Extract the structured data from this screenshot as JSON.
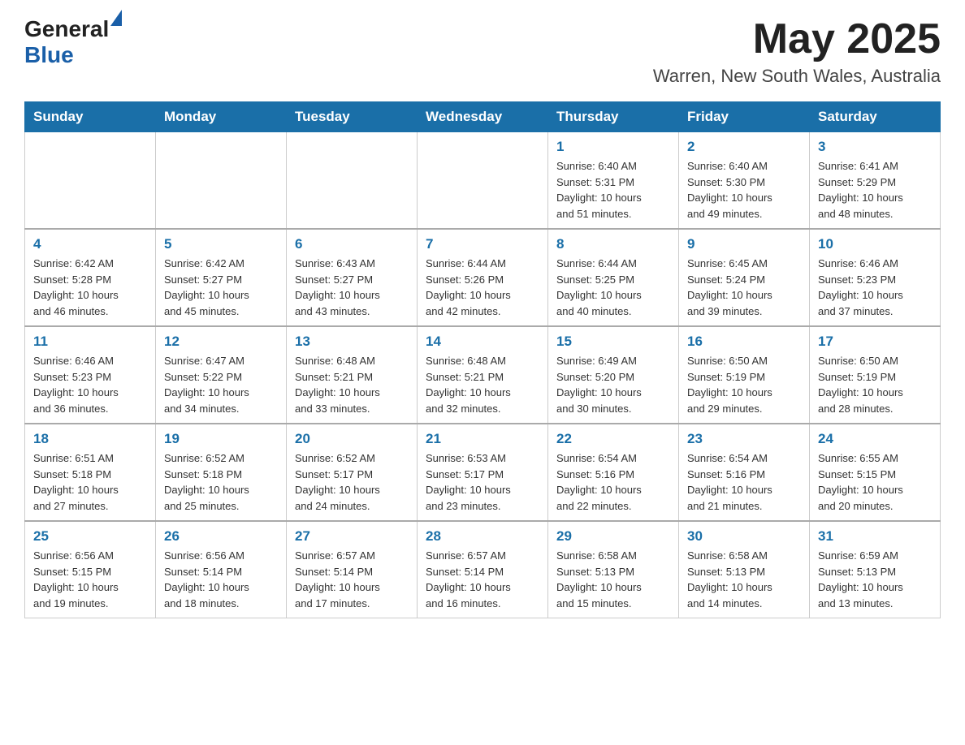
{
  "header": {
    "logo_general": "General",
    "logo_blue": "Blue",
    "title": "May 2025",
    "subtitle": "Warren, New South Wales, Australia"
  },
  "weekdays": [
    "Sunday",
    "Monday",
    "Tuesday",
    "Wednesday",
    "Thursday",
    "Friday",
    "Saturday"
  ],
  "weeks": [
    [
      {
        "day": "",
        "info": ""
      },
      {
        "day": "",
        "info": ""
      },
      {
        "day": "",
        "info": ""
      },
      {
        "day": "",
        "info": ""
      },
      {
        "day": "1",
        "info": "Sunrise: 6:40 AM\nSunset: 5:31 PM\nDaylight: 10 hours\nand 51 minutes."
      },
      {
        "day": "2",
        "info": "Sunrise: 6:40 AM\nSunset: 5:30 PM\nDaylight: 10 hours\nand 49 minutes."
      },
      {
        "day": "3",
        "info": "Sunrise: 6:41 AM\nSunset: 5:29 PM\nDaylight: 10 hours\nand 48 minutes."
      }
    ],
    [
      {
        "day": "4",
        "info": "Sunrise: 6:42 AM\nSunset: 5:28 PM\nDaylight: 10 hours\nand 46 minutes."
      },
      {
        "day": "5",
        "info": "Sunrise: 6:42 AM\nSunset: 5:27 PM\nDaylight: 10 hours\nand 45 minutes."
      },
      {
        "day": "6",
        "info": "Sunrise: 6:43 AM\nSunset: 5:27 PM\nDaylight: 10 hours\nand 43 minutes."
      },
      {
        "day": "7",
        "info": "Sunrise: 6:44 AM\nSunset: 5:26 PM\nDaylight: 10 hours\nand 42 minutes."
      },
      {
        "day": "8",
        "info": "Sunrise: 6:44 AM\nSunset: 5:25 PM\nDaylight: 10 hours\nand 40 minutes."
      },
      {
        "day": "9",
        "info": "Sunrise: 6:45 AM\nSunset: 5:24 PM\nDaylight: 10 hours\nand 39 minutes."
      },
      {
        "day": "10",
        "info": "Sunrise: 6:46 AM\nSunset: 5:23 PM\nDaylight: 10 hours\nand 37 minutes."
      }
    ],
    [
      {
        "day": "11",
        "info": "Sunrise: 6:46 AM\nSunset: 5:23 PM\nDaylight: 10 hours\nand 36 minutes."
      },
      {
        "day": "12",
        "info": "Sunrise: 6:47 AM\nSunset: 5:22 PM\nDaylight: 10 hours\nand 34 minutes."
      },
      {
        "day": "13",
        "info": "Sunrise: 6:48 AM\nSunset: 5:21 PM\nDaylight: 10 hours\nand 33 minutes."
      },
      {
        "day": "14",
        "info": "Sunrise: 6:48 AM\nSunset: 5:21 PM\nDaylight: 10 hours\nand 32 minutes."
      },
      {
        "day": "15",
        "info": "Sunrise: 6:49 AM\nSunset: 5:20 PM\nDaylight: 10 hours\nand 30 minutes."
      },
      {
        "day": "16",
        "info": "Sunrise: 6:50 AM\nSunset: 5:19 PM\nDaylight: 10 hours\nand 29 minutes."
      },
      {
        "day": "17",
        "info": "Sunrise: 6:50 AM\nSunset: 5:19 PM\nDaylight: 10 hours\nand 28 minutes."
      }
    ],
    [
      {
        "day": "18",
        "info": "Sunrise: 6:51 AM\nSunset: 5:18 PM\nDaylight: 10 hours\nand 27 minutes."
      },
      {
        "day": "19",
        "info": "Sunrise: 6:52 AM\nSunset: 5:18 PM\nDaylight: 10 hours\nand 25 minutes."
      },
      {
        "day": "20",
        "info": "Sunrise: 6:52 AM\nSunset: 5:17 PM\nDaylight: 10 hours\nand 24 minutes."
      },
      {
        "day": "21",
        "info": "Sunrise: 6:53 AM\nSunset: 5:17 PM\nDaylight: 10 hours\nand 23 minutes."
      },
      {
        "day": "22",
        "info": "Sunrise: 6:54 AM\nSunset: 5:16 PM\nDaylight: 10 hours\nand 22 minutes."
      },
      {
        "day": "23",
        "info": "Sunrise: 6:54 AM\nSunset: 5:16 PM\nDaylight: 10 hours\nand 21 minutes."
      },
      {
        "day": "24",
        "info": "Sunrise: 6:55 AM\nSunset: 5:15 PM\nDaylight: 10 hours\nand 20 minutes."
      }
    ],
    [
      {
        "day": "25",
        "info": "Sunrise: 6:56 AM\nSunset: 5:15 PM\nDaylight: 10 hours\nand 19 minutes."
      },
      {
        "day": "26",
        "info": "Sunrise: 6:56 AM\nSunset: 5:14 PM\nDaylight: 10 hours\nand 18 minutes."
      },
      {
        "day": "27",
        "info": "Sunrise: 6:57 AM\nSunset: 5:14 PM\nDaylight: 10 hours\nand 17 minutes."
      },
      {
        "day": "28",
        "info": "Sunrise: 6:57 AM\nSunset: 5:14 PM\nDaylight: 10 hours\nand 16 minutes."
      },
      {
        "day": "29",
        "info": "Sunrise: 6:58 AM\nSunset: 5:13 PM\nDaylight: 10 hours\nand 15 minutes."
      },
      {
        "day": "30",
        "info": "Sunrise: 6:58 AM\nSunset: 5:13 PM\nDaylight: 10 hours\nand 14 minutes."
      },
      {
        "day": "31",
        "info": "Sunrise: 6:59 AM\nSunset: 5:13 PM\nDaylight: 10 hours\nand 13 minutes."
      }
    ]
  ]
}
